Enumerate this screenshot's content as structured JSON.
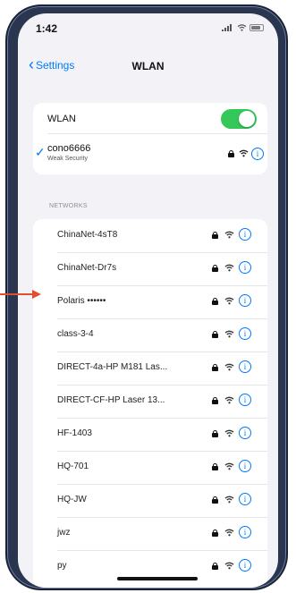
{
  "status_bar": {
    "time": "1:42"
  },
  "nav": {
    "back_label": "Settings",
    "title": "WLAN"
  },
  "wlan_card": {
    "label": "WLAN",
    "toggle_on": true,
    "connected": {
      "name": "cono6666",
      "subtitle": "Weak Security"
    }
  },
  "section_header": "NETWORKS",
  "networks": [
    {
      "name": "ChinaNet-4sT8"
    },
    {
      "name": "ChinaNet-Dr7s"
    },
    {
      "name": "Polaris ••••••"
    },
    {
      "name": "class-3-4"
    },
    {
      "name": "DIRECT-4a-HP M181 Las..."
    },
    {
      "name": "DIRECT-CF-HP Laser 13..."
    },
    {
      "name": "HF-1403"
    },
    {
      "name": "HQ-701"
    },
    {
      "name": "HQ-JW"
    },
    {
      "name": "jwz"
    },
    {
      "name": "py"
    }
  ],
  "colors": {
    "accent": "#007aff",
    "toggle": "#34c759",
    "arrow": "#e0502a",
    "frame": "#2a3550"
  }
}
